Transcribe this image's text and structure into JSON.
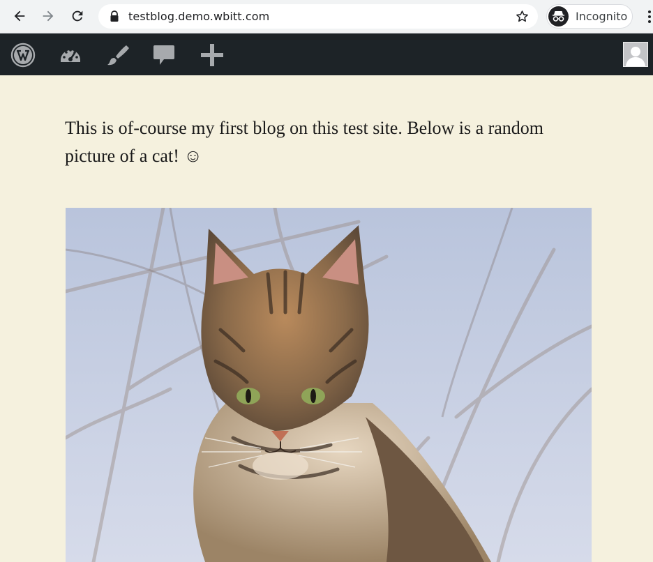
{
  "browser": {
    "url": "testblog.demo.wbitt.com",
    "mode_label": "Incognito",
    "icons": [
      "back-icon",
      "forward-icon",
      "reload-icon",
      "lock-icon",
      "star-icon",
      "incognito-icon",
      "menu-icon"
    ]
  },
  "admin_bar": {
    "icons": [
      "wordpress-logo-icon",
      "dashboard-icon",
      "customize-brush-icon",
      "comments-icon",
      "plus-icon",
      "user-avatar"
    ],
    "background": "#1d2327",
    "icon_color": "#a7aaad"
  },
  "post": {
    "body_text": "This is of-course my first blog on this test site. Below is a random picture of a cat! ☺",
    "image_subject": "tabby cat",
    "background": "#f5f1de"
  }
}
